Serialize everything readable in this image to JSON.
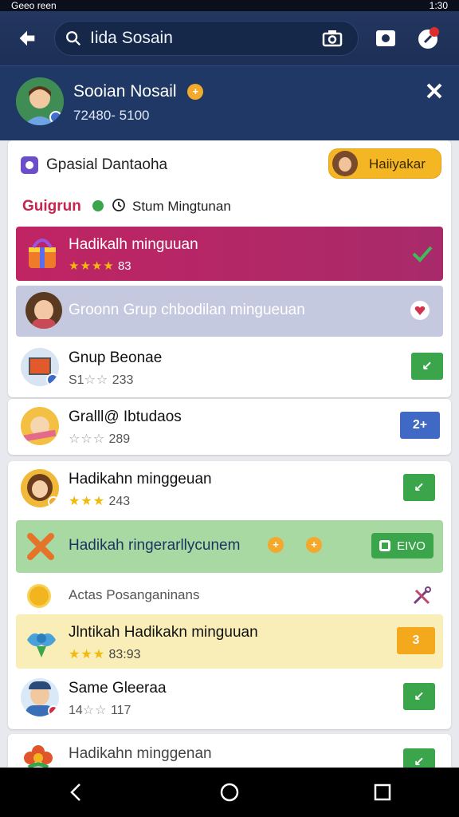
{
  "status": {
    "left": "Geeo reen",
    "right": "1:30"
  },
  "search": {
    "text": "Iida Sosain"
  },
  "profile": {
    "name": "Sooian Nosail",
    "sub": "72480- 5100"
  },
  "section": {
    "heading": "Gpasial Dantaoha",
    "chip_label": "Haiiyakar",
    "group_tab": "Guigrun",
    "status_line": "Stum Mingtunan"
  },
  "items": {
    "hadikah_top": {
      "title": "Hadikalh minguuan",
      "rating": "83"
    },
    "groom": {
      "title": "Groonn Grup chbodilan mingueuan"
    },
    "grup_beonae": {
      "title": "Gnup Beonae",
      "meta_prefix": "S1",
      "rating": "233",
      "btn": "↙"
    },
    "gralll": {
      "title": "Gralll@ Ibtudaos",
      "rating": "289",
      "btn": "2+"
    },
    "hadikahn": {
      "title": "Hadikahn minggeuan",
      "rating": "243"
    },
    "ringe": {
      "title": "Hadikah ringerarllycunem",
      "btn_label": "EIVO"
    },
    "actas": {
      "title": "Actas Posanganinans"
    },
    "jintikah": {
      "title": "Jlntikah Hadikakn minguuan",
      "rating": "83:93",
      "btn": "3"
    },
    "same": {
      "title": "Same Gleeraa",
      "meta_prefix": "14",
      "rating": "117"
    },
    "last": {
      "title": "Hadikahn minggenan"
    }
  },
  "colors": {
    "appbar": "#23365f",
    "profile": "#1f3866",
    "accent_green": "#3aa54a",
    "accent_blue": "#3f69c4",
    "accent_orange": "#f4a91d",
    "highlight_magenta": "#c02463"
  },
  "icons": [
    "back-arrow-icon",
    "search-icon",
    "camera-icon",
    "photo-icon",
    "notification-icon",
    "close-icon",
    "check-icon",
    "heart-icon",
    "tools-icon"
  ]
}
